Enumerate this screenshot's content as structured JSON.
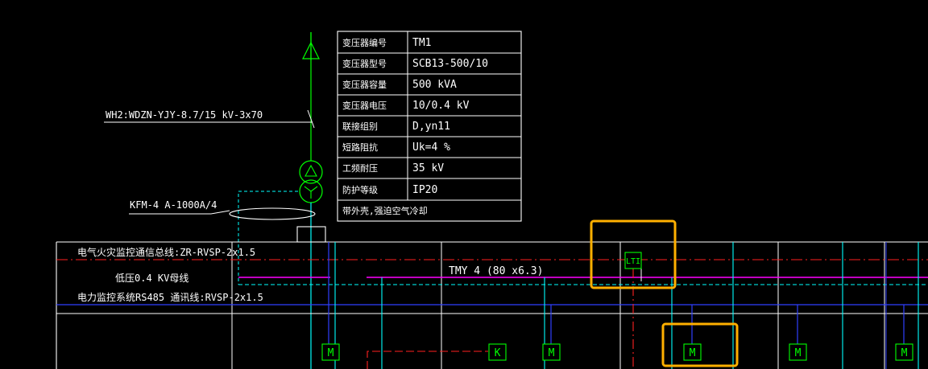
{
  "transformer_table": {
    "rows": [
      {
        "label": "变压器编号",
        "value": "TM1"
      },
      {
        "label": "变压器型号",
        "value": "SCB13-500/10"
      },
      {
        "label": "变压器容量",
        "value": "500 kVA"
      },
      {
        "label": "变压器电压",
        "value": "10/0.4 kV"
      },
      {
        "label": "联接组别",
        "value": "D,yn11"
      },
      {
        "label": "短路阻抗",
        "value": "Uk=4 %"
      },
      {
        "label": "工频耐压",
        "value": "35 kV"
      },
      {
        "label": "防护等级",
        "value": "IP20"
      }
    ],
    "note": "带外壳,强迫空气冷却"
  },
  "labels": {
    "incoming_cable": "WH2:WDZN-YJY-8.7/15 kV-3x70",
    "ct": "KFM-4 A-1000A/4",
    "fire_bus": "电气火灾监控通信总线:ZR-RVSP-2x1.5",
    "lv_bus": "低压0.4 KV母线",
    "busbar_spec": "TMY 4 (80 x6.3)",
    "rs485_bus": "电力监控系统RS485 通讯线:RVSP-2x1.5"
  },
  "symbols": {
    "lti": "LTI",
    "k": "K",
    "m": "M"
  },
  "colors": {
    "background": "#000000",
    "white": "#ffffff",
    "green": "#00ff00",
    "cyan": "#00ffff",
    "magenta": "#ff00ff",
    "blue": "#2f3fff",
    "red": "#ff2020",
    "highlight": "#ffb000"
  }
}
